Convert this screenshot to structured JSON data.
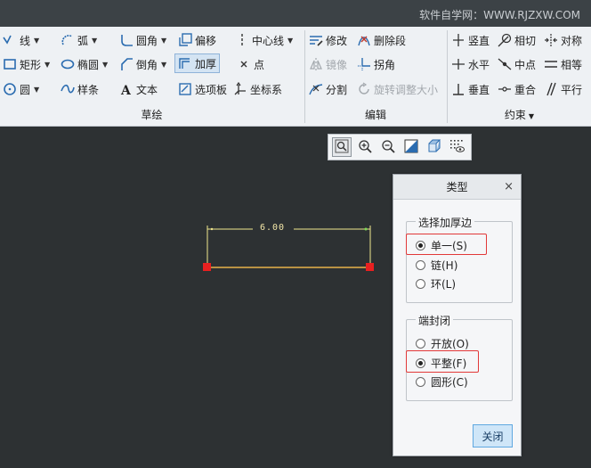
{
  "watermark": "软件自学网：WWW.RJZXW.COM",
  "ribbon": {
    "sketch": {
      "label": "草绘",
      "tools": {
        "line": "线",
        "arc": "弧",
        "fillet": "圆角",
        "offset": "偏移",
        "centerline": "中心线",
        "rectangle": "矩形",
        "ellipse": "椭圆",
        "chamfer": "倒角",
        "thicken": "加厚",
        "point": "点",
        "circle": "圆",
        "spline": "样条",
        "text": "文本",
        "palette": "选项板",
        "coordsys": "坐标系"
      }
    },
    "edit": {
      "label": "编辑",
      "tools": {
        "modify": "修改",
        "delete_segment": "删除段",
        "mirror": "镜像",
        "corner": "拐角",
        "divide": "分割",
        "rotate_resize": "旋转调整大小"
      }
    },
    "constrain": {
      "label": "约束",
      "tools": {
        "vertical": "竖直",
        "tangent": "相切",
        "symmetric": "对称",
        "horizontal": "水平",
        "midpoint": "中点",
        "equal": "相等",
        "perpendicular": "垂直",
        "coincident": "重合",
        "parallel": "平行"
      }
    }
  },
  "canvas": {
    "dimension": "6.00"
  },
  "dialog": {
    "title": "类型",
    "close_x": "×",
    "edge_group": {
      "legend": "选择加厚边",
      "options": [
        "单一(S)",
        "链(H)",
        "环(L)"
      ],
      "selected": "单一(S)"
    },
    "cap_group": {
      "legend": "端封闭",
      "options": [
        "开放(O)",
        "平整(F)",
        "圆形(C)"
      ],
      "selected": "平整(F)"
    },
    "close_button": "关闭"
  },
  "colors": {
    "background": "#2d3133",
    "sketch_line": "#f0e68c",
    "endpoint": "#e82020",
    "highlight": "#e23838"
  }
}
